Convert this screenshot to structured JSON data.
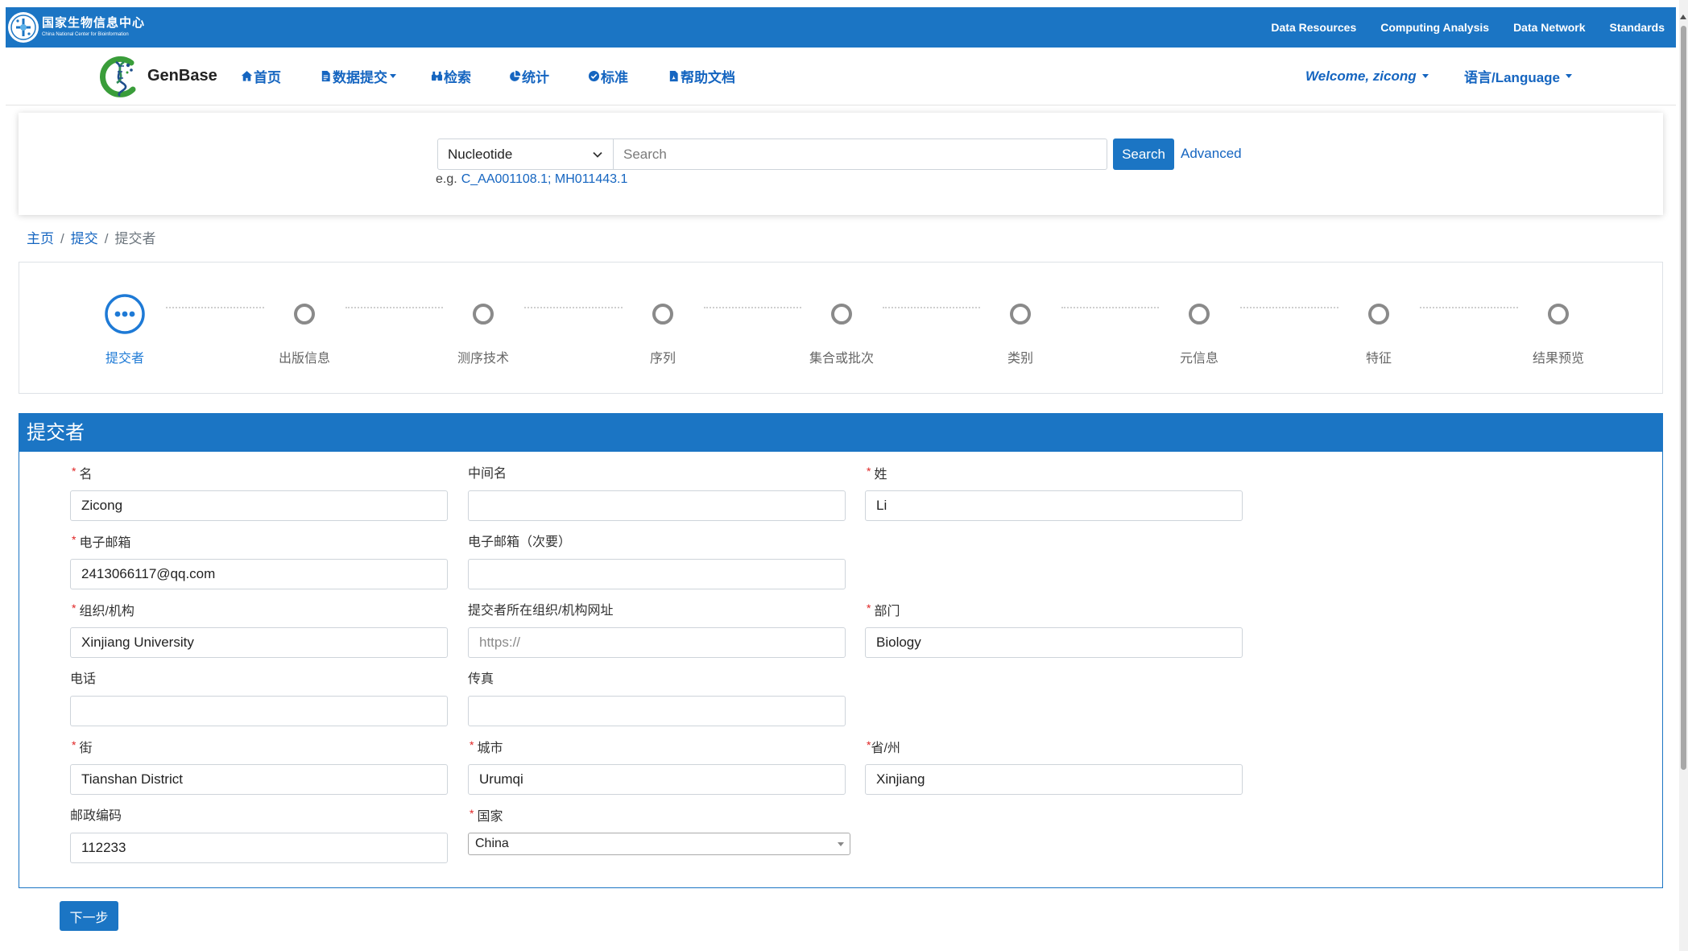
{
  "colors": {
    "primary": "#1b75c4",
    "link": "#1565c0",
    "required": "#e02424",
    "step_active": "#1e7ad6",
    "step_inactive": "#8a8a8a"
  },
  "header": {
    "org_name": "国家生物信息中心",
    "org_subtitle": "China National Center for Bioinformation",
    "links": [
      "Data Resources",
      "Computing Analysis",
      "Data Network",
      "Standards"
    ]
  },
  "nav": {
    "brand": "GenBase",
    "items": [
      {
        "label": "首页",
        "icon": "home-icon"
      },
      {
        "label": "数据提交",
        "icon": "file-icon"
      },
      {
        "label": "检索",
        "icon": "binoculars-icon"
      },
      {
        "label": "统计",
        "icon": "pie-chart-icon"
      },
      {
        "label": "标准",
        "icon": "check-circle-icon"
      },
      {
        "label": "帮助文档",
        "icon": "file-pdf-icon"
      }
    ],
    "user_menu": "Welcome, zicong",
    "language_menu": "语言/Language"
  },
  "search": {
    "database": "Nucleotide",
    "placeholder": "Search",
    "button": "Search",
    "advanced": "Advanced",
    "example_prefix": "e.g.",
    "example_ids": "C_AA001108.1; MH011443.1"
  },
  "breadcrumb": {
    "separator": "/",
    "items": [
      "主页",
      "提交",
      "提交者"
    ]
  },
  "steps": {
    "current_index": 0,
    "items": [
      "提交者",
      "出版信息",
      "测序技术",
      "序列",
      "集合或批次",
      "类别",
      "元信息",
      "特征",
      "结果预览"
    ]
  },
  "form": {
    "title": "提交者",
    "required_mark": "*",
    "fields": {
      "first_name": {
        "label": "名",
        "required": true,
        "value": "Zicong"
      },
      "middle_name": {
        "label": "中间名"
      },
      "last_name": {
        "label": "姓",
        "required": true,
        "value": "Li"
      },
      "email": {
        "label": "电子邮箱",
        "required": true,
        "value": "2413066117@qq.com"
      },
      "email_secondary": {
        "label": "电子邮箱（次要）"
      },
      "organization": {
        "label": "组织/机构",
        "required": true,
        "value": "Xinjiang University"
      },
      "organization_url": {
        "label": "提交者所在组织/机构网址",
        "placeholder": "https://"
      },
      "department": {
        "label": "部门",
        "required": true,
        "value": "Biology"
      },
      "phone": {
        "label": "电话"
      },
      "fax": {
        "label": "传真"
      },
      "street": {
        "label": "街",
        "required": true,
        "value": "Tianshan District"
      },
      "city": {
        "label": "城市",
        "required": true,
        "value": "Urumqi"
      },
      "state": {
        "label": "省/州",
        "required": true,
        "value": "Xinjiang"
      },
      "postal_code": {
        "label": "邮政编码",
        "value": "112233"
      },
      "country": {
        "label": "国家",
        "required": true,
        "value": "China"
      }
    },
    "next_button": "下一步"
  }
}
